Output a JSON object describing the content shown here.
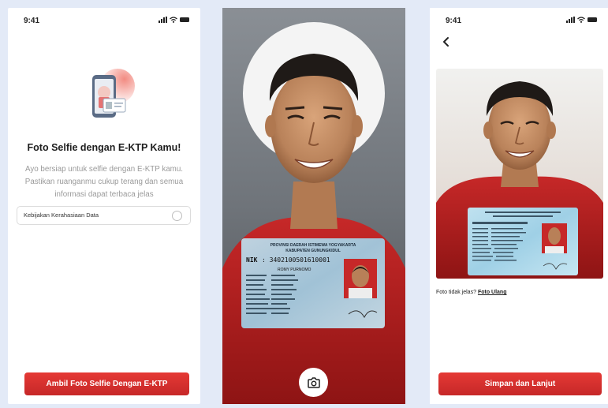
{
  "status_bar": {
    "time": "9:41"
  },
  "intro_screen": {
    "title": "Foto Selfie dengan E-KTP Kamu!",
    "description": "Ayo bersiap untuk selfie dengan E-KTP kamu. Pastikan ruanganmu cukup terang dan semua informasi dapat terbaca jelas",
    "policy_label": "Kebijakan Kerahasiaan Data",
    "button_label": "Ambil Foto Selfie Dengan E-KTP"
  },
  "camera_screen": {
    "card": {
      "province": "PROVINSI DAERAH ISTIMEWA YOGYAKARTA",
      "regency": "KABUPATEN GUNUNGKIDUL",
      "nik_label": "NIK",
      "nik": ": 3402100501610001",
      "name": "ROMY PURNOMO"
    }
  },
  "confirm_screen": {
    "question": "Foto tidak jelas?",
    "retake_link": "Foto Ulang",
    "button_label": "Simpan dan Lanjut"
  },
  "colors": {
    "primary_red": "#d32f2f",
    "page_bg": "#e3eaf7"
  },
  "icons": [
    "cellular-signal-icon",
    "wifi-icon",
    "battery-icon",
    "back-chevron-icon",
    "camera-icon"
  ]
}
